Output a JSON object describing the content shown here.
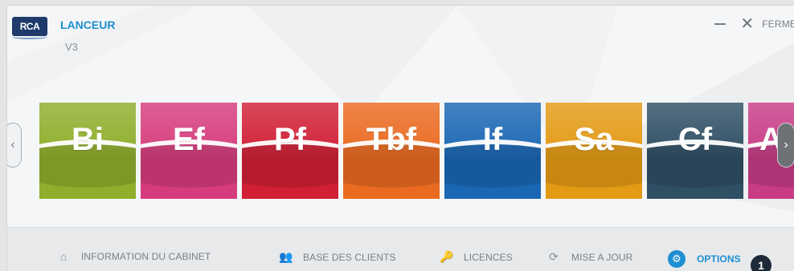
{
  "header": {
    "logo_text": "RCA",
    "title": "LANCEUR",
    "version": "V3",
    "close_label": "FERMER"
  },
  "tiles": [
    {
      "label": "Bi",
      "color": "#8fae2b"
    },
    {
      "label": "Ef",
      "color": "#d63c7d"
    },
    {
      "label": "Pf",
      "color": "#d11f35"
    },
    {
      "label": "Tbf",
      "color": "#ea6a20"
    },
    {
      "label": "If",
      "color": "#1a67b4"
    },
    {
      "label": "Sa",
      "color": "#e39a14"
    },
    {
      "label": "Cf",
      "color": "#2f4f64"
    },
    {
      "label": "A",
      "color": "#c83c86"
    }
  ],
  "toolbar": {
    "items": [
      {
        "label": "INFORMATION DU CABINET",
        "icon": "home-icon"
      },
      {
        "label": "BASE DES CLIENTS",
        "icon": "users-icon"
      },
      {
        "label": "LICENCES",
        "icon": "key-icon"
      },
      {
        "label": "MISE A JOUR",
        "icon": "refresh-icon"
      },
      {
        "label": "OPTIONS",
        "icon": "gear-icon"
      }
    ]
  },
  "badge": "1",
  "colors": {
    "accent": "#1e8fd0",
    "text_muted": "#7b7f84"
  }
}
